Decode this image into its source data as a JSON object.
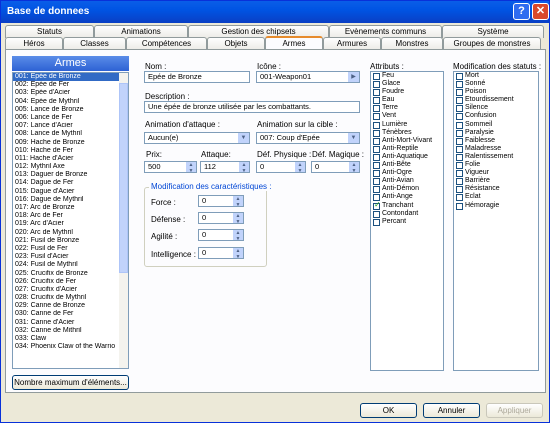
{
  "window": {
    "title": "Base de donnees"
  },
  "tabs_row1": [
    "Statuts",
    "Animations",
    "Gestion des chipsets",
    "Evènements communs",
    "Système"
  ],
  "tabs_row2": [
    "Héros",
    "Classes",
    "Compétences",
    "Objets",
    "Armes",
    "Armures",
    "Monstres",
    "Groupes de monstres"
  ],
  "list": {
    "header": "Armes",
    "items": [
      "001: Epée de Bronze",
      "002: Epée de Fer",
      "003: Epée d'Acier",
      "004: Epée de Mythril",
      "005: Lance de Bronze",
      "006: Lance de Fer",
      "007: Lance d'Acier",
      "008: Lance de Mythril",
      "009: Hache de Bronze",
      "010: Hache de Fer",
      "011: Hache d'Acier",
      "012: Mythril Axe",
      "013: Daguer de Bronze",
      "014: Dague de Fer",
      "015: Dague d'Acier",
      "016: Dague de Mythril",
      "017: Arc de Bronze",
      "018: Arc de Fer",
      "019: Arc d'Acier",
      "020: Arc de Mythril",
      "021: Fusil de Bronze",
      "022: Fusil de Fer",
      "023: Fusil d'Acier",
      "024: Fusil de Mythril",
      "025: Crucifix de Bronze",
      "026: Crucifix de Fer",
      "027: Crucifix d'Acier",
      "028: Crucifix de Mythril",
      "029: Canne de Bronze",
      "030: Canne de Fer",
      "031: Canne d'Acier",
      "032: Canne de Mithril",
      "033: Claw",
      "034: Phoenix Claw of the Warrio"
    ],
    "selected_index": 0,
    "max_button": "Nombre maximum d'éléments..."
  },
  "form": {
    "nom_label": "Nom :",
    "nom": "Epée de Bronze",
    "icone_label": "Icône :",
    "icone": "001-Weapon01",
    "desc_label": "Description :",
    "desc": "Une épée de bronze utilisée par les combattants.",
    "anim_attaque_label": "Animation d'attaque :",
    "anim_attaque": "Aucun(e)",
    "anim_cible_label": "Animation sur la cible :",
    "anim_cible": "007: Coup d'Epée",
    "prix_label": "Prix:",
    "prix": "500",
    "attaque_label": "Attaque:",
    "attaque": "112",
    "def_phys_label": "Déf. Physique :",
    "def_phys": "0",
    "def_mag_label": "Déf. Magique :",
    "def_mag": "0",
    "mod_title": "Modification des caractéristiques :",
    "force_label": "Force :",
    "force": "0",
    "defense_label": "Défense :",
    "defense": "0",
    "agilite_label": "Agilité :",
    "agilite": "0",
    "intel_label": "Intelligence :",
    "intel": "0"
  },
  "attributs": {
    "title": "Attributs :",
    "items": [
      "Feu",
      "Glace",
      "Foudre",
      "Eau",
      "Terre",
      "Vent",
      "Lumière",
      "Ténèbres",
      "Anti-Mort-Vivant",
      "Anti-Reptile",
      "Anti-Aquatique",
      "Anti-Bête",
      "Anti-Ogre",
      "Anti-Avian",
      "Anti-Démon",
      "Anti-Ange",
      "Tranchant",
      "Contondant",
      "Percant"
    ],
    "checked": [
      "Tranchant"
    ]
  },
  "statuts": {
    "title": "Modification des statuts :",
    "items": [
      "Mort",
      "Sonné",
      "Poison",
      "Etourdissement",
      "Silence",
      "Confusion",
      "Sommeil",
      "Paralysie",
      "Faiblesse",
      "Maladresse",
      "Ralentissement",
      "Folie",
      "Vigueur",
      "Barrière",
      "Résistance",
      "Eclat",
      "Hémoragie"
    ]
  },
  "buttons": {
    "ok": "OK",
    "cancel": "Annuler",
    "apply": "Appliquer"
  },
  "colors": {
    "titlebar": "#0054e3",
    "selection": "#316ac5",
    "tab_highlight": "#e68b2c",
    "group_title": "#0046d5"
  }
}
